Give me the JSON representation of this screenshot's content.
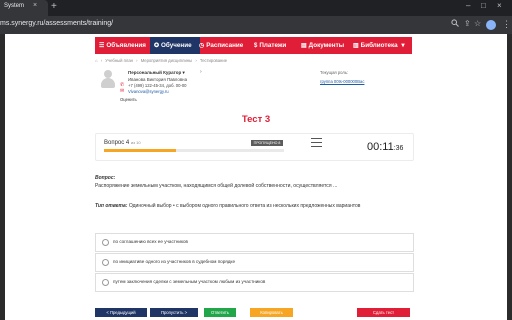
{
  "browser": {
    "tab_title": "System",
    "tab_close": "×",
    "new_tab": "+",
    "window_controls": [
      "–",
      "□",
      "×"
    ],
    "url": "ms.synergy.ru/assessments/training/",
    "url_icons": [
      "search-icon",
      "share-icon",
      "star-icon"
    ]
  },
  "nav": {
    "items": [
      {
        "icon": "☰",
        "label": "Объявления",
        "active": false
      },
      {
        "icon": "✪",
        "label": "Обучение",
        "active": true
      },
      {
        "icon": "◷",
        "label": "Расписание",
        "active": false
      },
      {
        "icon": "$",
        "label": "Платежи",
        "active": false
      },
      {
        "icon": "▤",
        "label": "Документы",
        "active": false
      },
      {
        "icon": "▥",
        "label": "Библиотека",
        "active": false
      }
    ],
    "more": "▾"
  },
  "breadcrumb": {
    "home_icon": "⌂",
    "items": [
      "Учебный план",
      "Мероприятия дисциплины",
      "Тестирование"
    ],
    "separator": "›"
  },
  "curator": {
    "title": "Персональный Куратор",
    "title_arrow": "▾",
    "name": "Иванова Виктория Павловна",
    "phone": "+7 (499) 122-45-34, доб. 00-00",
    "email": "Vivanova@synergy.ru",
    "rate": "Оценить",
    "expand_icon": "›"
  },
  "role": {
    "label": "Текущая роль:",
    "value": "группа 00ts-000000Вас"
  },
  "test": {
    "title": "Тест 3",
    "question_label": "Вопрос 4",
    "question_of": "из 10",
    "progress": 0.4,
    "badge": "ПРОПУЩЕНО 8",
    "timer_main": "00:11",
    "timer_sec": ":36",
    "vopros_label": "Вопрос:",
    "question_text": "Распоряжение земельным участком, находящимся общей долевой собственности, осуществляется ...",
    "type_label": "Тип ответа:",
    "type_value": "Одиночный выбор • с выбором одного правильного ответа из нескольких предложенных вариантов"
  },
  "options": [
    "по соглашению всех ее участников",
    "по инициативе одного из участников в судебном порядке",
    "путем заключения сделки с земельным участком любым из участников"
  ],
  "buttons": {
    "prev": "< Предыдущий",
    "skip": "Пропустить >",
    "answer": "Ответить",
    "copy": "Копировать",
    "submit": "Сдать тест"
  },
  "colors": {
    "brand_red": "#e01e37",
    "nav_active": "#1f3566",
    "progress": "#f6a623",
    "btn_dark": "#1f3566",
    "btn_green": "#22a64a",
    "btn_orange": "#f6a623"
  }
}
